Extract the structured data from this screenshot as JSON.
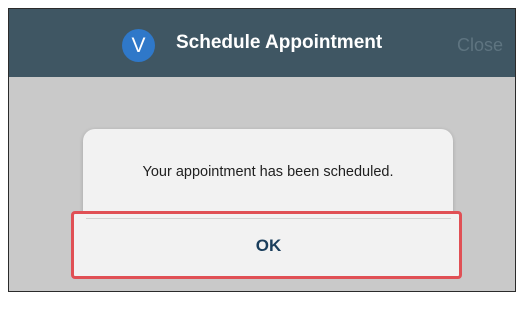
{
  "header": {
    "logo_letter": "V",
    "title": "Schedule Appointment",
    "close_label": "Close"
  },
  "dialog": {
    "message": "Your appointment has been scheduled.",
    "ok_label": "OK"
  },
  "colors": {
    "header_bg": "#3f5663",
    "logo_bg": "#2f78c9",
    "highlight_border": "#e05055",
    "ok_text": "#1a3e5c"
  }
}
